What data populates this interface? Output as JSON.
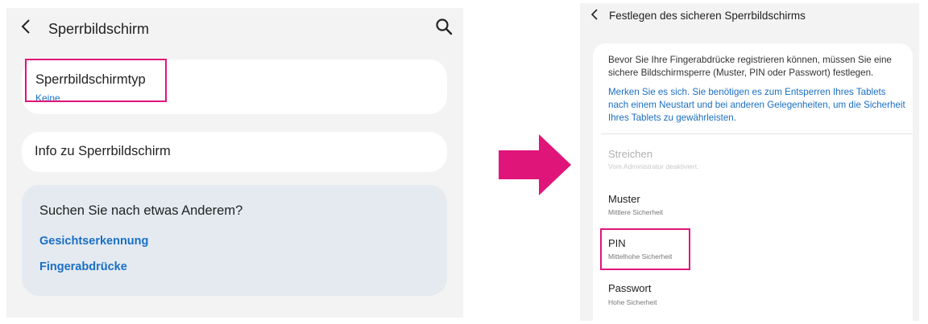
{
  "left": {
    "header": {
      "back_icon": "chevron-left-icon",
      "title": "Sperrbildschirm",
      "search_icon": "search-icon"
    },
    "lock_type": {
      "title": "Sperrbildschirmtyp",
      "value": "Keine"
    },
    "info": {
      "title": "Info zu Sperrbildschirm"
    },
    "more": {
      "title": "Suchen Sie nach etwas Anderem?",
      "links": [
        "Gesichtserkennung",
        "Fingerabdrücke"
      ]
    }
  },
  "right": {
    "header": {
      "back_icon": "chevron-left-icon",
      "title": "Festlegen des sicheren Sperrbildschirms"
    },
    "description": "Bevor Sie Ihre Fingerabdrücke registrieren können, müssen Sie eine sichere Bildschirmsperre (Muster, PIN oder Passwort) festlegen.",
    "note": "Merken Sie es sich. Sie benötigen es zum Entsperren Ihres Tablets nach einem Neustart und bei anderen Gelegenheiten, um die Sicherheit Ihres Tablets zu gewährleisten.",
    "options": [
      {
        "title": "Streichen",
        "subtitle": "Vom Administrator deaktiviert."
      },
      {
        "title": "Muster",
        "subtitle": "Mittlere Sicherheit"
      },
      {
        "title": "PIN",
        "subtitle": "Mittelhohe Sicherheit"
      },
      {
        "title": "Passwort",
        "subtitle": "Hohe Sicherheit"
      }
    ]
  },
  "colors": {
    "highlight": "#e0157a",
    "link": "#1a6fc4",
    "panel_bg": "#f3f3f3",
    "card_more_bg": "#e4eaf0"
  }
}
